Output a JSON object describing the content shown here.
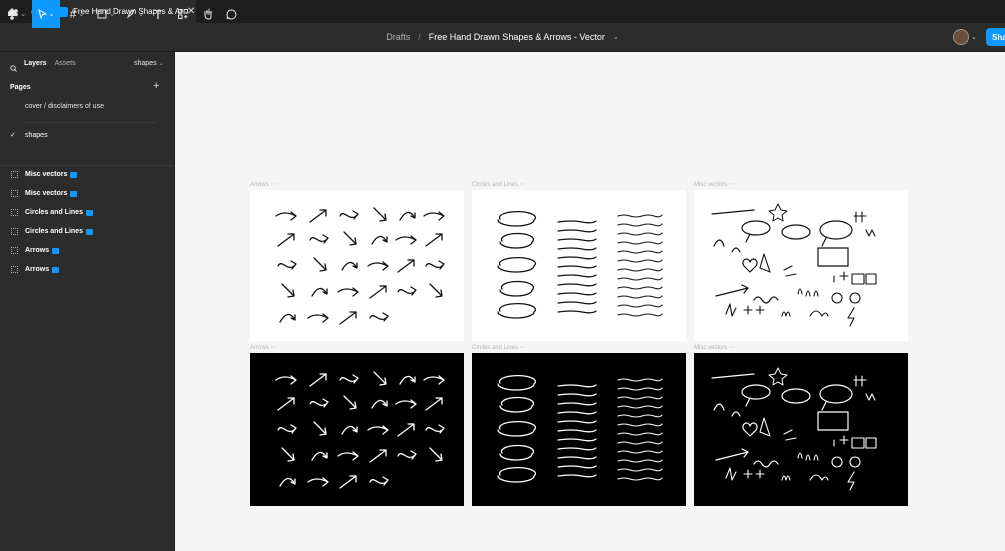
{
  "tabbar": {
    "active_tab_title": "Free Hand Drawn Shapes & Arrows - Vector",
    "close_glyph": "✕",
    "new_tab_glyph": "+"
  },
  "toolbar": {
    "breadcrumb_root": "Drafts",
    "breadcrumb_sep": "/",
    "file_name": "Free Hand Drawn Shapes & Arrows - Vector",
    "file_menu_glyph": "⌄",
    "share_label": "Sha",
    "icons": [
      "figma-menu-icon",
      "move-tool-icon",
      "frame-tool-icon",
      "shape-tool-icon",
      "pen-tool-icon",
      "text-tool-icon",
      "resources-icon",
      "hand-tool-icon",
      "comment-tool-icon"
    ]
  },
  "sidebar": {
    "tabs": [
      "Layers",
      "Assets"
    ],
    "page_select": "shapes",
    "pages_header": "Pages",
    "add_page_glyph": "+",
    "pages": [
      "cover / disclaimers of use",
      "shapes"
    ],
    "selected_page_check": "✓",
    "layers": [
      "Misc vectors",
      "Misc vectors",
      "Circles and Lines",
      "Circles and Lines",
      "Arrows",
      "Arrows"
    ]
  },
  "canvas": {
    "frames": [
      {
        "label": "Arrows",
        "theme": "light",
        "kind": "arrows"
      },
      {
        "label": "Circles and Lines",
        "theme": "light",
        "kind": "lines"
      },
      {
        "label": "Misc vectors",
        "theme": "light",
        "kind": "misc"
      },
      {
        "label": "Arrows",
        "theme": "dark",
        "kind": "arrows"
      },
      {
        "label": "Circles and Lines",
        "theme": "dark",
        "kind": "lines"
      },
      {
        "label": "Misc vectors",
        "theme": "dark",
        "kind": "misc"
      }
    ],
    "frame_label_suffix": "⋯"
  },
  "colors": {
    "accent": "#0d99ff",
    "panel": "#2c2c2c",
    "canvas": "#f5f5f5"
  }
}
